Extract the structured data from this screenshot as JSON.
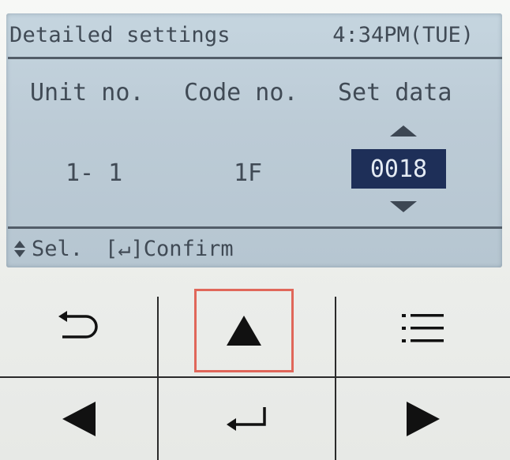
{
  "screen": {
    "title": "Detailed settings",
    "clock": "4:34PM(TUE)",
    "columns": {
      "unit": "Unit no.",
      "code": "Code no.",
      "set": "Set data"
    },
    "values": {
      "unit": "1- 1",
      "code": "1F",
      "set": "0018"
    },
    "footer": {
      "select": "Sel.",
      "confirm": "[↵]Confirm"
    }
  },
  "buttons": [
    {
      "name": "back-button",
      "icon": "return-arrow-icon"
    },
    {
      "name": "up-button",
      "icon": "triangle-up-icon",
      "highlighted": true,
      "highlight_color": "#e0675a"
    },
    {
      "name": "menu-button",
      "icon": "menu-list-icon"
    },
    {
      "name": "left-button",
      "icon": "triangle-left-icon"
    },
    {
      "name": "enter-button",
      "icon": "enter-icon"
    },
    {
      "name": "right-button",
      "icon": "triangle-right-icon"
    }
  ],
  "colors": {
    "lcd_background": "#c2d2dc",
    "lcd_text": "#404a55",
    "selected_value_background": "#1e2f58",
    "panel_background": "#f2f3f1"
  }
}
